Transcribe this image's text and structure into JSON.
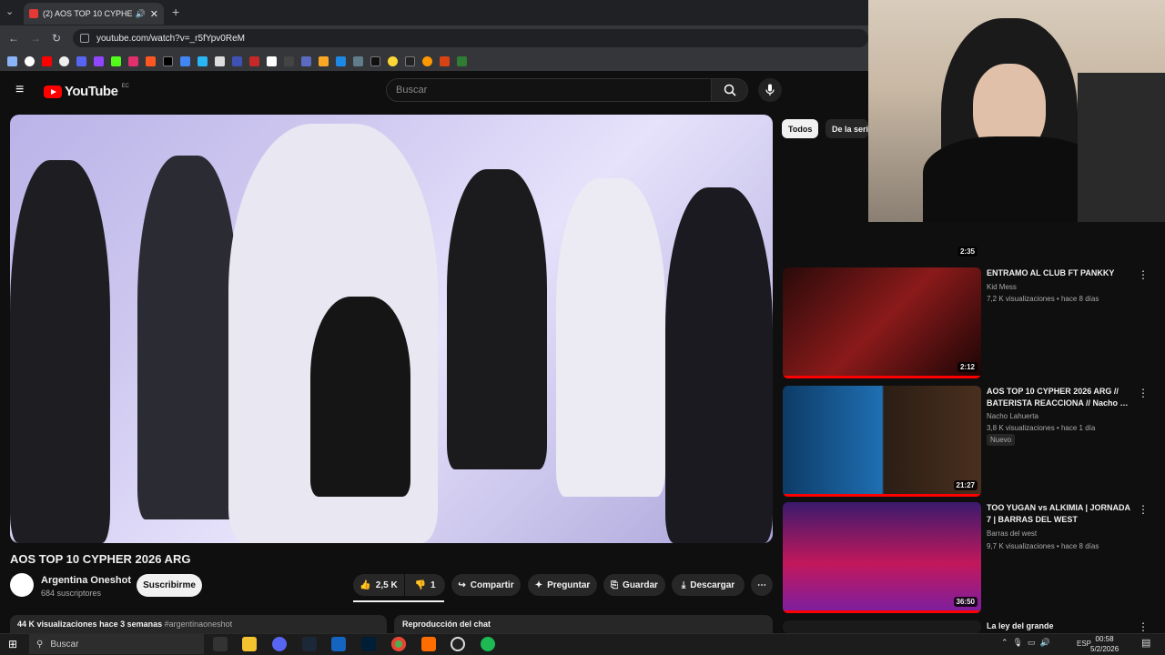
{
  "browser": {
    "tab_title": "(2) AOS TOP 10 CYPHER 20…",
    "url": "youtube.com/watch?v=_r5fYpv0ReM",
    "new_tab": "+",
    "tab_close": "✕"
  },
  "youtube": {
    "logo_text": "YouTube",
    "region": "EC",
    "search_placeholder": "Buscar"
  },
  "video": {
    "title": "AOS TOP 10 CYPHER 2026 ARG",
    "channel": "Argentina Oneshot",
    "subscribers": "684 suscriptores",
    "subscribe_label": "Suscribirme",
    "likes": "2,5 K",
    "dislikes": "1",
    "share_label": "Compartir",
    "ask_label": "Preguntar",
    "save_label": "Guardar",
    "download_label": "Descargar",
    "views": "44 K visualizaciones",
    "date": "hace 3 semanas",
    "hashtag": "#argentinaoneshot",
    "chat_replay": "Reproducción del chat"
  },
  "sidebar": {
    "chips": [
      "Todos",
      "De la serie"
    ],
    "items": [
      {
        "duration": "2:35",
        "title": "",
        "channel": "",
        "meta": "",
        "progress": 0
      },
      {
        "duration": "2:12",
        "title": "ENTRAMO AL CLUB FT PANKKY",
        "channel": "Kid Mess",
        "meta": "7,2 K visualizaciones • hace 8 días",
        "progress": 1.0
      },
      {
        "duration": "21:27",
        "title": "AOS TOP 10 CYPHER 2026 ARG // BATERISTA REACCIONA // Nacho …",
        "channel": "Nacho Lahuerta",
        "meta": "3,8 K visualizaciones • hace 1 día",
        "badge": "Nuevo",
        "progress": 1.0
      },
      {
        "duration": "36:50",
        "title": "TOO YUGAN vs ALKIMIA | JORNADA 7 | BARRAS DEL WEST",
        "channel": "Barras del west",
        "meta": "9,7 K visualizaciones • hace 8 días",
        "progress": 1.0
      },
      {
        "duration": "",
        "title": "La ley del grande",
        "channel": "",
        "meta": "",
        "progress": 0
      }
    ]
  },
  "taskbar": {
    "search_placeholder": "Buscar",
    "language": "ESP",
    "time": "00:58",
    "date": "5/2/2026"
  },
  "colors": {
    "accent_red": "#ff0000",
    "background": "#0f0f0f",
    "chip_active": "#f1f1f1"
  }
}
